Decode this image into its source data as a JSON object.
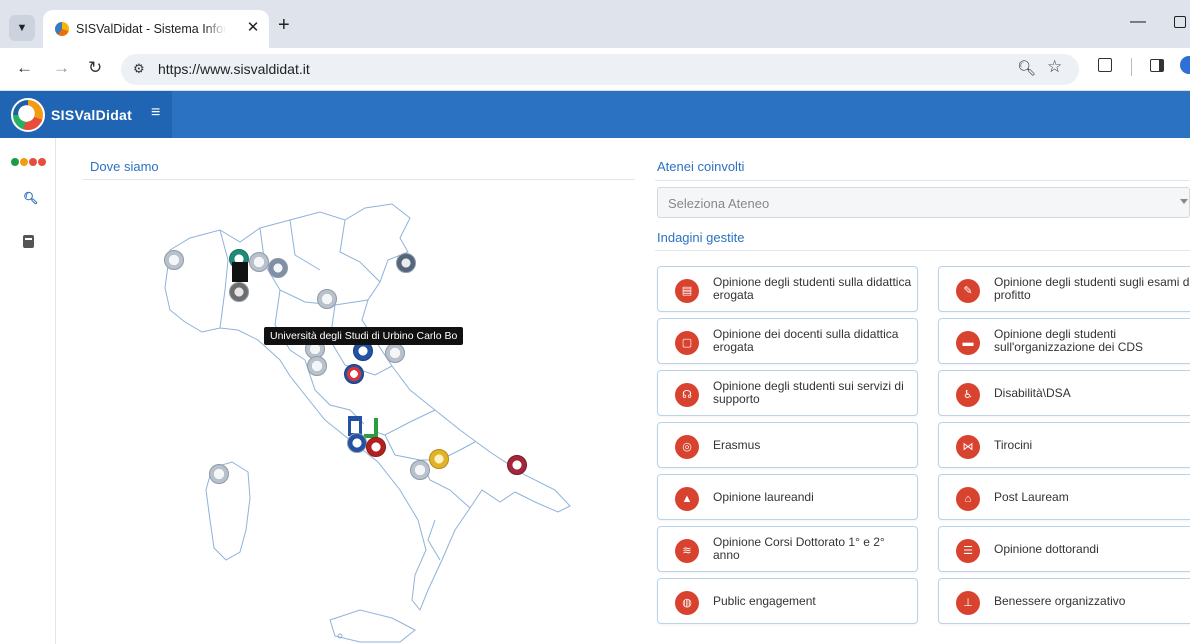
{
  "browser": {
    "tab_title": "SISValDidat - Sistema Informativo",
    "tab_close": "✕",
    "new_tab": "+",
    "url": "https://www.sisvaldidat.it",
    "minimize": "—"
  },
  "app": {
    "brand": "SISValDidat",
    "menu_icon": "≡",
    "brand_colors": [
      "#1e9b4a",
      "#f39c12",
      "#e74c3c",
      "#e74c3c"
    ]
  },
  "sections": {
    "where": "Dove siamo",
    "universities": "Atenei coinvolti",
    "surveys": "Indagini gestite"
  },
  "select": {
    "placeholder": "Seleziona Ateneo"
  },
  "map_tooltip": "Università degli Studi di Urbino Carlo Bo",
  "surveys": [
    {
      "label": "Opinione degli studenti sulla didattica erogata",
      "icon": "chalkboard-icon"
    },
    {
      "label": "Opinione degli studenti sugli esami di profitto",
      "icon": "user-edit-icon"
    },
    {
      "label": "Opinione dei docenti sulla didattica erogata",
      "icon": "presentation-icon"
    },
    {
      "label": "Opinione degli studenti sull'organizzazione dei CDS",
      "icon": "book-icon"
    },
    {
      "label": "Opinione degli studenti sui servizi di supporto",
      "icon": "headset-icon"
    },
    {
      "label": "Disabilità\\DSA",
      "icon": "wheelchair-icon"
    },
    {
      "label": "Erasmus",
      "icon": "globe-icon"
    },
    {
      "label": "Tirocini",
      "icon": "network-icon"
    },
    {
      "label": "Opinione laureandi",
      "icon": "graduation-cap-icon"
    },
    {
      "label": "Post Lauream",
      "icon": "building-icon"
    },
    {
      "label": "Opinione Corsi Dottorato 1° e 2° anno",
      "icon": "layers-icon"
    },
    {
      "label": "Opinione dottorandi",
      "icon": "document-icon"
    },
    {
      "label": "Public engagement",
      "icon": "database-icon"
    },
    {
      "label": "Benessere organizzativo",
      "icon": "org-chart-icon"
    }
  ]
}
